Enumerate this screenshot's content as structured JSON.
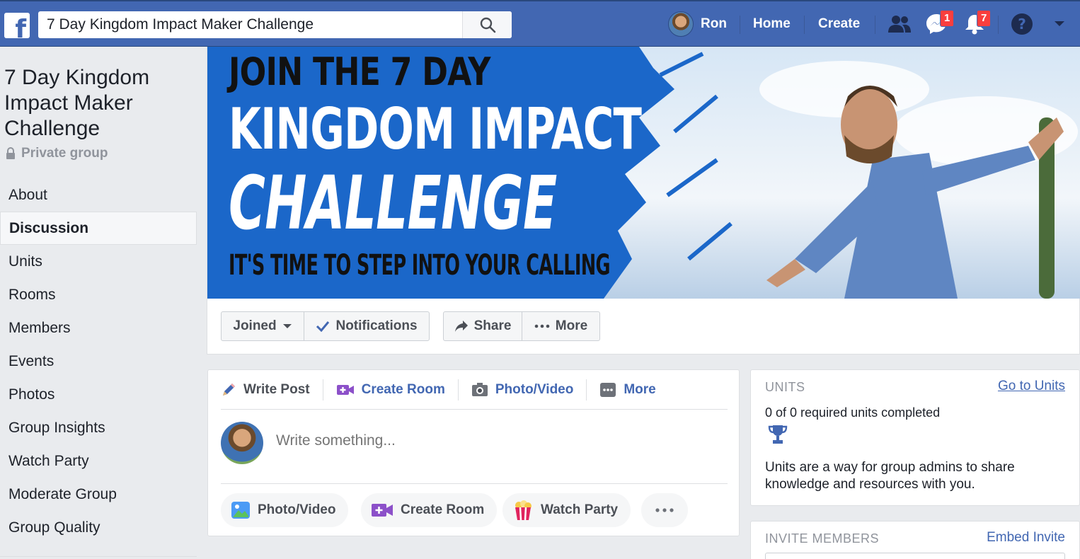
{
  "colors": {
    "brand": "#4267b2",
    "link": "#4267b2",
    "badge": "#fa3e3e",
    "bg": "#e9ebee"
  },
  "topbar": {
    "logo_letter": "f",
    "search_value": "7 Day Kingdom Impact Maker Challenge",
    "user_name": "Ron",
    "home_label": "Home",
    "create_label": "Create",
    "messages_badge": "1",
    "notifications_badge": "7"
  },
  "group": {
    "title": "7 Day Kingdom Impact Maker Challenge",
    "privacy": "Private group"
  },
  "sidebar": {
    "items": [
      {
        "label": "About"
      },
      {
        "label": "Discussion",
        "active": true
      },
      {
        "label": "Units"
      },
      {
        "label": "Rooms"
      },
      {
        "label": "Members"
      },
      {
        "label": "Events"
      },
      {
        "label": "Photos"
      },
      {
        "label": "Group Insights"
      },
      {
        "label": "Watch Party"
      },
      {
        "label": "Moderate Group"
      },
      {
        "label": "Group Quality"
      }
    ]
  },
  "cover": {
    "line1": "JOIN THE 7 DAY",
    "line2": "KINGDOM IMPACT",
    "line3": "CHALLENGE",
    "line4": "IT'S TIME TO STEP INTO YOUR CALLING"
  },
  "actions": {
    "joined": "Joined",
    "notifications": "Notifications",
    "share": "Share",
    "more": "More"
  },
  "composer": {
    "tabs": [
      "Write Post",
      "Create Room",
      "Photo/Video",
      "More"
    ],
    "placeholder": "Write something...",
    "pills": [
      "Photo/Video",
      "Create Room",
      "Watch Party"
    ]
  },
  "units": {
    "heading": "UNITS",
    "link": "Go to Units",
    "progress": "0 of 0 required units completed",
    "description": "Units are a way for group admins to share knowledge and resources with you."
  },
  "invite": {
    "heading": "INVITE MEMBERS",
    "link": "Embed Invite"
  }
}
